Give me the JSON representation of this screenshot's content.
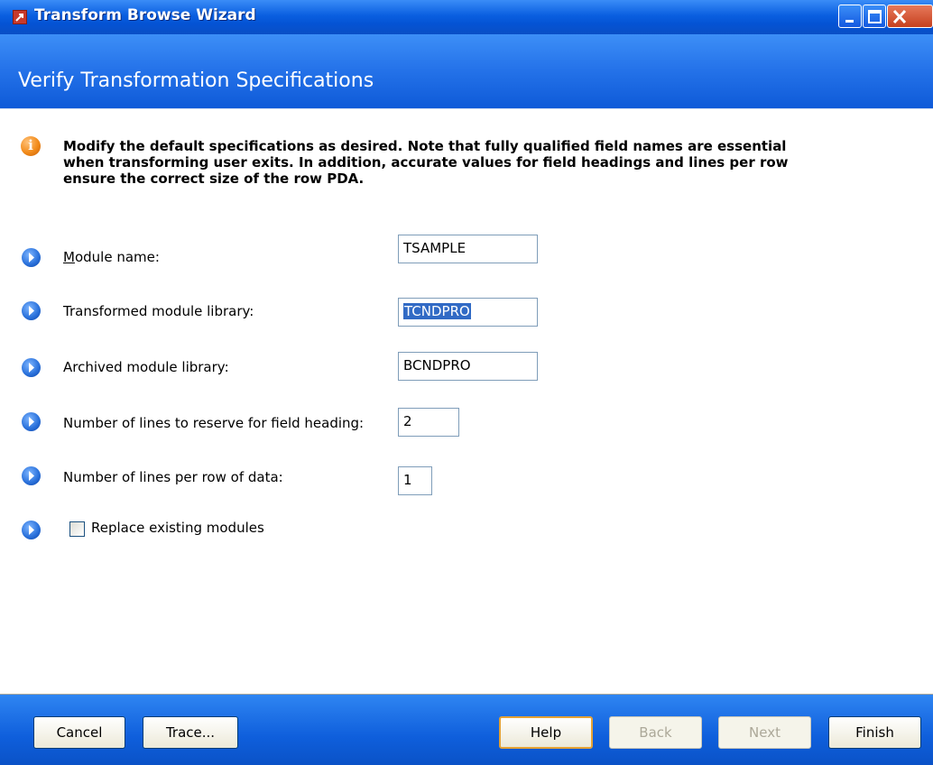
{
  "window": {
    "title": "Transform Browse Wizard",
    "icon": "wizard-app-icon",
    "controls": [
      "minimize-icon",
      "maximize-icon",
      "close-icon"
    ]
  },
  "header": {
    "title": "Verify Transformation Specifications"
  },
  "info": {
    "icon": "info-icon",
    "text": "Modify the default specifications as desired. Note that fully qualified field names are essential when transforming user exits. In addition, accurate values for field headings and lines per row ensure the correct size of the row PDA."
  },
  "fields": {
    "module_name": {
      "label": "Module name:",
      "value": "TSAMPLE"
    },
    "transformed_library": {
      "label": "Transformed module library:",
      "value": "TCNDPRO"
    },
    "archived_library": {
      "label": "Archived module library:",
      "value": "BCNDPRO"
    },
    "heading_lines": {
      "label": "Number of lines to reserve  for  field heading:",
      "value": "2"
    },
    "lines_per_row": {
      "label": "Number of lines per row of data:",
      "value": "1"
    },
    "replace_modules": {
      "label": "Replace existing modules",
      "checked": false
    }
  },
  "buttons": {
    "cancel": "Cancel",
    "trace": "Trace...",
    "help": "Help",
    "back": "Back",
    "next": "Next",
    "finish": "Finish"
  },
  "colors": {
    "titlebar": "#0a5fe0",
    "header": "#2674ea",
    "footer": "#0f5fdc",
    "selection": "#316ac5"
  }
}
